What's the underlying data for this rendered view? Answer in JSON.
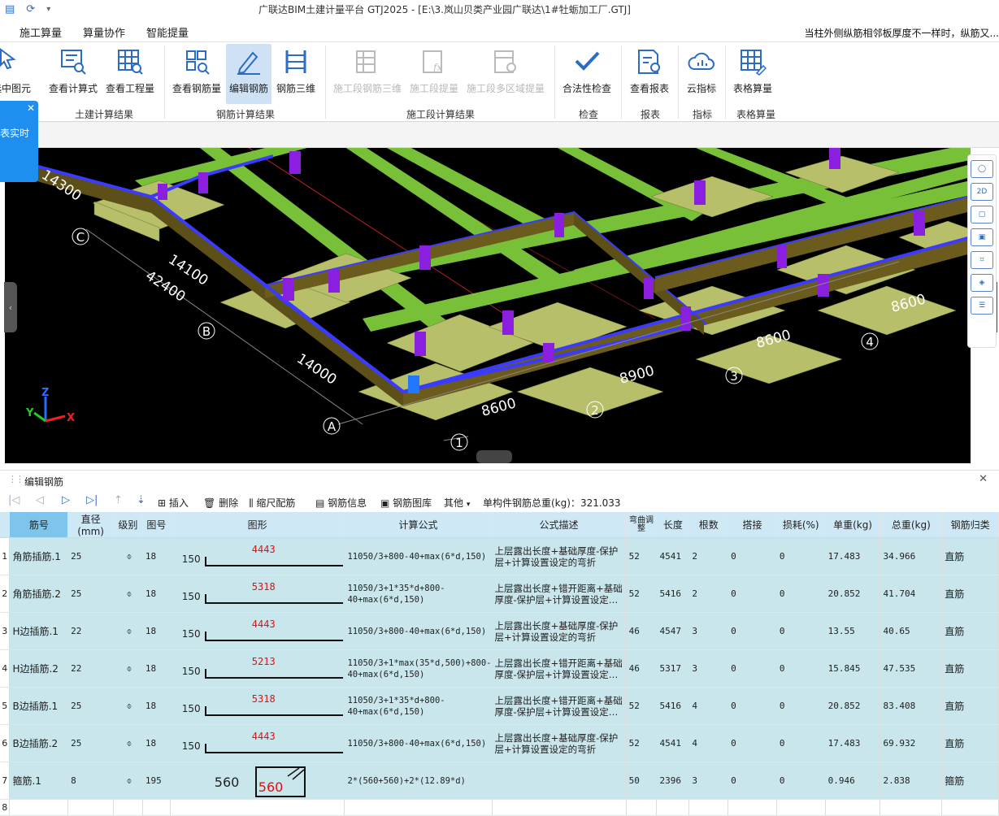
{
  "window": {
    "title": "广联达BIM土建计量平台 GTJ2025 - [E:\\3.岚山贝类产业园广联达\\1#牡蛎加工厂.GTJ]",
    "quick_access": [
      "save-icon",
      "sync-icon",
      "dropdown-icon"
    ],
    "quick_access_glyphs": [
      "▤",
      "⟳",
      "▾"
    ]
  },
  "menu": {
    "tabs": [
      "施工算量",
      "算量协作",
      "智能提量"
    ],
    "notice": "当柱外侧纵筋相邻板厚度不一样时，纵筋又..."
  },
  "ribbon": {
    "cut_label": "选中图元",
    "buttons": [
      {
        "label": "查看计算式",
        "icon": "formula-view-icon",
        "disabled": false
      },
      {
        "label": "查看工程量",
        "icon": "quantity-view-icon",
        "disabled": false
      },
      {
        "label": "查看钢筋量",
        "icon": "rebar-quantity-icon",
        "disabled": false
      },
      {
        "label": "编辑钢筋",
        "icon": "edit-rebar-icon",
        "disabled": false,
        "active": true
      },
      {
        "label": "钢筋三维",
        "icon": "rebar-3d-icon",
        "disabled": false
      },
      {
        "label": "施工段钢筋三维",
        "icon": "segment-rebar-3d-icon",
        "disabled": true
      },
      {
        "label": "施工段提量",
        "icon": "segment-extract-icon",
        "disabled": true
      },
      {
        "label": "施工段多区域提量",
        "icon": "segment-multi-area-icon",
        "disabled": true
      },
      {
        "label": "合法性检查",
        "icon": "check-icon",
        "disabled": false
      },
      {
        "label": "查看报表",
        "icon": "report-icon",
        "disabled": false
      },
      {
        "label": "云指标",
        "icon": "cloud-index-icon",
        "disabled": false
      },
      {
        "label": "表格算量",
        "icon": "table-calc-icon",
        "disabled": false
      }
    ],
    "groups": [
      "土建计算结果",
      "钢筋计算结果",
      "施工段计算结果",
      "检查",
      "报表",
      "指标",
      "表格算量"
    ]
  },
  "popup": {
    "text": "表实时",
    "close": "✕"
  },
  "viewport": {
    "dimensions": [
      "14300",
      "14100",
      "42400",
      "14000",
      "8600",
      "8900",
      "8600",
      "8600"
    ],
    "axes": [
      "A",
      "B",
      "C",
      "1",
      "2",
      "3",
      "4"
    ],
    "gizmo": {
      "x": "X",
      "y": "Y",
      "z": "Z"
    },
    "view_tools": [
      "orbit-icon",
      "2d-view-icon",
      "3d-view-icon",
      "3d-solid-icon",
      "crop-icon",
      "layer-icon",
      "view-settings-icon"
    ],
    "view_tool_glyphs": [
      "◯",
      "2D",
      "▢",
      "▣",
      "⌗",
      "◈",
      "☰"
    ]
  },
  "panel": {
    "title": "编辑钢筋",
    "close": "✕",
    "toolbar": {
      "nav_glyphs": [
        "|◁",
        "◁",
        "▷",
        "▷|"
      ],
      "insert": "插入",
      "delete": "删除",
      "scale_rebar": "缩尺配筋",
      "rebar_info": "钢筋信息",
      "rebar_library": "钢筋图库",
      "other": "其他",
      "total_label": "单构件钢筋总重(kg)：",
      "total_value": "321.033"
    }
  },
  "table": {
    "columns": [
      "筋号",
      "直径(mm)",
      "级别",
      "图号",
      "图形",
      "计算公式",
      "公式描述",
      "弯曲调整",
      "长度",
      "根数",
      "搭接",
      "损耗(%)",
      "单重(kg)",
      "总重(kg)",
      "钢筋归类"
    ],
    "rows": [
      {
        "n": "1",
        "name": "角筋插筋.1",
        "dia": "25",
        "grade": "⌽",
        "fig": "18",
        "left": "150",
        "mid": "4443",
        "formula": "11050/3+800-40+max(6*d,150)",
        "desc": "上层露出长度+基础厚度-保护层+计算设置设定的弯折",
        "bend": "52",
        "len": "4541",
        "count": "2",
        "lap": "0",
        "loss": "0",
        "unit": "17.483",
        "total": "34.966",
        "type": "直筋"
      },
      {
        "n": "2",
        "name": "角筋插筋.2",
        "dia": "25",
        "grade": "⌽",
        "fig": "18",
        "left": "150",
        "mid": "5318",
        "formula": "11050/3+1*35*d+800-40+max(6*d,150)",
        "desc": "上层露出长度+错开距离+基础厚度-保护层+计算设置设定…",
        "bend": "52",
        "len": "5416",
        "count": "2",
        "lap": "0",
        "loss": "0",
        "unit": "20.852",
        "total": "41.704",
        "type": "直筋"
      },
      {
        "n": "3",
        "name": "H边插筋.1",
        "dia": "22",
        "grade": "⌽",
        "fig": "18",
        "left": "150",
        "mid": "4443",
        "formula": "11050/3+800-40+max(6*d,150)",
        "desc": "上层露出长度+基础厚度-保护层+计算设置设定的弯折",
        "bend": "46",
        "len": "4547",
        "count": "3",
        "lap": "0",
        "loss": "0",
        "unit": "13.55",
        "total": "40.65",
        "type": "直筋"
      },
      {
        "n": "4",
        "name": "H边插筋.2",
        "dia": "22",
        "grade": "⌽",
        "fig": "18",
        "left": "150",
        "mid": "5213",
        "formula": "11050/3+1*max(35*d,500)+800-40+max(6*d,150)",
        "desc": "上层露出长度+错开距离+基础厚度-保护层+计算设置设定…",
        "bend": "46",
        "len": "5317",
        "count": "3",
        "lap": "0",
        "loss": "0",
        "unit": "15.845",
        "total": "47.535",
        "type": "直筋"
      },
      {
        "n": "5",
        "name": "B边插筋.1",
        "dia": "25",
        "grade": "⌽",
        "fig": "18",
        "left": "150",
        "mid": "5318",
        "formula": "11050/3+1*35*d+800-40+max(6*d,150)",
        "desc": "上层露出长度+错开距离+基础厚度-保护层+计算设置设定…",
        "bend": "52",
        "len": "5416",
        "count": "4",
        "lap": "0",
        "loss": "0",
        "unit": "20.852",
        "total": "83.408",
        "type": "直筋"
      },
      {
        "n": "6",
        "name": "B边插筋.2",
        "dia": "25",
        "grade": "⌽",
        "fig": "18",
        "left": "150",
        "mid": "4443",
        "formula": "11050/3+800-40+max(6*d,150)",
        "desc": "上层露出长度+基础厚度-保护层+计算设置设定的弯折",
        "bend": "52",
        "len": "4541",
        "count": "4",
        "lap": "0",
        "loss": "0",
        "unit": "17.483",
        "total": "69.932",
        "type": "直筋"
      },
      {
        "n": "7",
        "name": "箍筋.1",
        "dia": "8",
        "grade": "⌽",
        "fig": "195",
        "left": "560",
        "mid": "560",
        "formula": "2*(560+560)+2*(12.89*d)",
        "desc": "",
        "bend": "50",
        "len": "2396",
        "count": "3",
        "lap": "0",
        "loss": "0",
        "unit": "0.946",
        "total": "2.838",
        "type": "箍筋"
      }
    ],
    "empty_row": "8"
  },
  "colors": {
    "row_bg": "#c8e6ec",
    "header_bg": "#cfe8f5",
    "shape_dim": "#d11111",
    "beam_green": "#8fd44a",
    "beam_brown": "#6b5b1c",
    "beam_blue": "#3b3bff",
    "column_purple": "#8b1fe0"
  }
}
